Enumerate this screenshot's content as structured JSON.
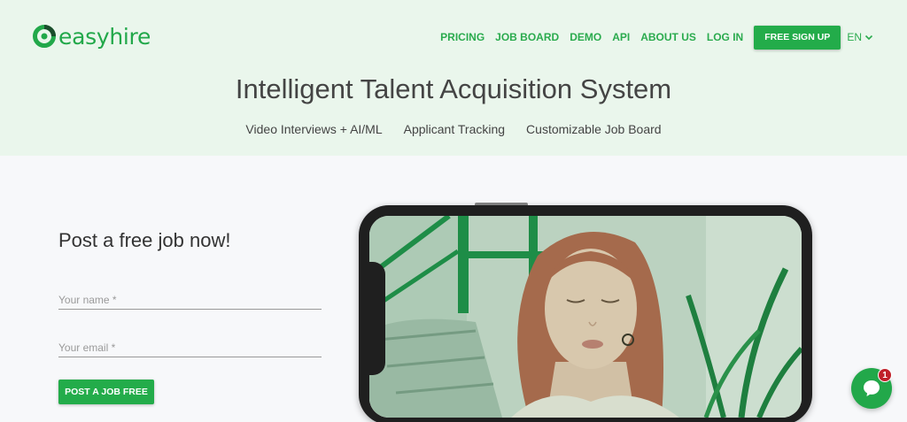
{
  "brand": {
    "name": "easyhire",
    "color": "#22a84a"
  },
  "nav": {
    "links": [
      "PRICING",
      "JOB BOARD",
      "DEMO",
      "API",
      "ABOUT US",
      "LOG IN"
    ],
    "signup_label": "FREE SIGN UP",
    "language": "EN"
  },
  "hero": {
    "title": "Intelligent Talent Acquisition System",
    "features": [
      "Video Interviews + AI/ML",
      "Applicant Tracking",
      "Customizable Job Board"
    ]
  },
  "form": {
    "title": "Post a free job now!",
    "name_placeholder": "Your name *",
    "email_placeholder": "Your email *",
    "submit_label": "POST A JOB FREE"
  },
  "chat": {
    "badge_count": "1"
  },
  "icons": {
    "language_dropdown": "chevron-down-icon",
    "chat": "chat-bubble-icon",
    "logo": "easyhire-logo-icon"
  }
}
